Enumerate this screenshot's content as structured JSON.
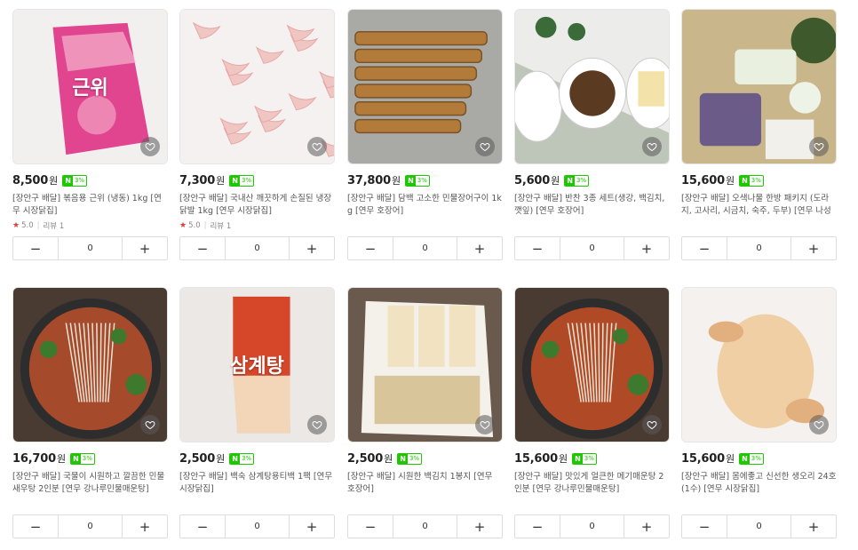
{
  "products": [
    {
      "price": "8,500",
      "currency": "원",
      "npay": "3%",
      "title": "[장안구 배달] 볶음용 근위 (냉동) 1kg [연무 시장닭집]",
      "rating": "5.0",
      "reviews": "리뷰 1",
      "qty": "0",
      "image_text": "근위",
      "colors": {
        "bg": "#f2f0ef",
        "main": "#e2458f",
        "accent": "#f8c8d8"
      }
    },
    {
      "price": "7,300",
      "currency": "원",
      "npay": "3%",
      "title": "[장안구 배달] 국내산 깨끗하게 손질된 냉장 닭발 1kg [연무 시장닭집]",
      "rating": "5.0",
      "reviews": "리뷰 1",
      "qty": "0",
      "colors": {
        "bg": "#f6f1f1",
        "main": "#efc6c2",
        "accent": "#e7a7a6"
      }
    },
    {
      "price": "37,800",
      "currency": "원",
      "npay": "3%",
      "title": "[장안구 배달] 담백 고소한 민물장어구이 1kg [연무 호장어]",
      "qty": "0",
      "colors": {
        "bg": "#a9a9a6",
        "main": "#b27b3a",
        "accent": "#7a5226"
      }
    },
    {
      "price": "5,600",
      "currency": "원",
      "npay": "3%",
      "title": "[장안구 배달] 반찬 3종 세트(생강, 백김치, 깻잎) [연무 호장어]",
      "qty": "0",
      "colors": {
        "bg": "#ececea",
        "main": "#5b3a22",
        "accent": "#f3e2a9"
      }
    },
    {
      "price": "15,600",
      "currency": "원",
      "npay": "3%",
      "title": "[장안구 배달] 오색나물 한방 패키지 (도라지, 고사리, 시금치, 숙주, 두부) [연무 나성상회]",
      "qty": "0",
      "colors": {
        "bg": "#c9b68a",
        "main": "#3e5a2c",
        "accent": "#6b5b88"
      }
    },
    {
      "price": "16,700",
      "currency": "원",
      "npay": "3%",
      "title": "[장안구 배달] 국물이 시원하고 깔끔한 민물새우탕 2인분 [연무 강나루민물매운탕]",
      "qty": "0",
      "colors": {
        "bg": "#4a3b32",
        "main": "#a54a2b",
        "accent": "#e9e4d6"
      }
    },
    {
      "price": "2,500",
      "currency": "원",
      "npay": "3%",
      "title": "[장안구 배달] 백숙 삼계탕용티백 1팩 [연무 시장닭집]",
      "qty": "0",
      "image_text": "삼계탕",
      "colors": {
        "bg": "#ece8e6",
        "main": "#d6472a",
        "accent": "#f3d5b8"
      }
    },
    {
      "price": "2,500",
      "currency": "원",
      "npay": "3%",
      "title": "[장안구 배달] 시원한 백김치 1봉지 [연무 호장어]",
      "qty": "0",
      "colors": {
        "bg": "#6a5a4e",
        "main": "#f1e3c2",
        "accent": "#d9c59a"
      }
    },
    {
      "price": "15,600",
      "currency": "원",
      "npay": "3%",
      "title": "[장안구 배달] 맛있게 얼큰한 메기매운탕 2인분 [연무 강나루민물매운탕]",
      "qty": "0",
      "colors": {
        "bg": "#4a3b32",
        "main": "#b04a26",
        "accent": "#e9e4d6"
      }
    },
    {
      "price": "15,600",
      "currency": "원",
      "npay": "3%",
      "title": "[장안구 배달] 몸에좋고 신선한 생오리 24호(1수) [연무 시장닭집]",
      "qty": "0",
      "colors": {
        "bg": "#f4f1ee",
        "main": "#f1cfa4",
        "accent": "#e2b07e"
      }
    }
  ],
  "stepper": {
    "minus": "−",
    "plus": "+"
  },
  "icons": {
    "wish": "heart-icon",
    "minus": "minus-icon",
    "plus": "plus-icon",
    "star": "star-icon"
  }
}
